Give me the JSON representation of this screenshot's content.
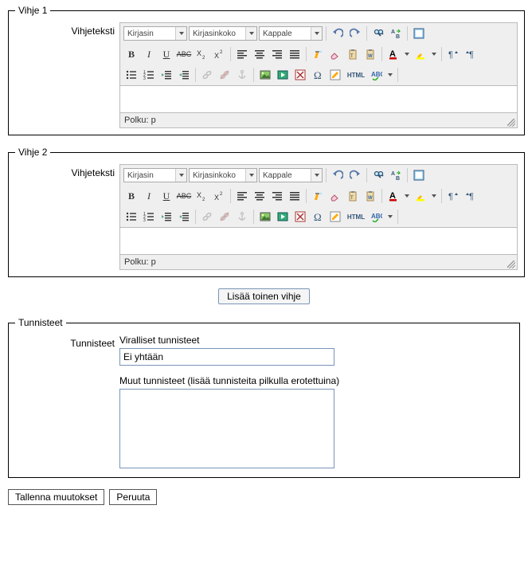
{
  "hints": [
    {
      "legend": "Vihje 1",
      "label": "Vihjeteksti",
      "font_family": "Kirjasin",
      "font_size": "Kirjasinkoko",
      "format": "Kappale",
      "path_text": "Polku: p"
    },
    {
      "legend": "Vihje 2",
      "label": "Vihjeteksti",
      "font_family": "Kirjasin",
      "font_size": "Kirjasinkoko",
      "format": "Kappale",
      "path_text": "Polku: p"
    }
  ],
  "add_hint_button": "Lisää toinen vihje",
  "tags": {
    "legend": "Tunnisteet",
    "label": "Tunnisteet",
    "official_label": "Viralliset tunnisteet",
    "official_value": "Ei yhtään",
    "other_label": "Muut tunnisteet (lisää tunnisteita pilkulla erotettuina)",
    "other_value": ""
  },
  "save_button": "Tallenna muutokset",
  "cancel_button": "Peruuta",
  "icons": {
    "undo": "↶",
    "redo": "↷",
    "find": "🔍",
    "html_label": "HTML"
  },
  "colors": {
    "toolbar_bg": "#efefef",
    "border": "#bbbbbb",
    "accent": "#7a94b8"
  }
}
